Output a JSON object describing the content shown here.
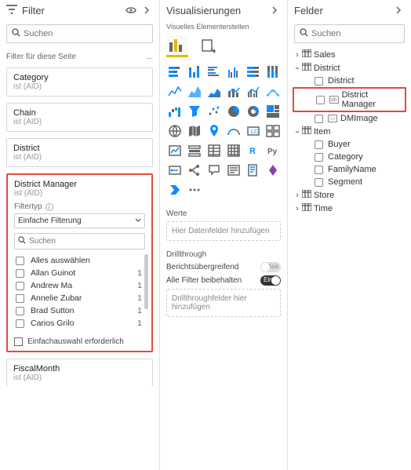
{
  "filter": {
    "title": "Filter",
    "search_placeholder": "Suchen",
    "section_label": "Filter für diese Seite",
    "ellipsis": "...",
    "cards": [
      {
        "title": "Category",
        "sub": "ist (AID)"
      },
      {
        "title": "Chain",
        "sub": "ist (AID)"
      },
      {
        "title": "District",
        "sub": "ist (AID)"
      }
    ],
    "dm": {
      "title": "District Manager",
      "sub": "ist (AID)",
      "filtertyp_label": "Filtertyp",
      "dropdown_value": "Einfache Filterung",
      "search_placeholder": "Suchen",
      "items": [
        {
          "name": "Alles auswählen",
          "count": ""
        },
        {
          "name": "Allan Guinot",
          "count": "1"
        },
        {
          "name": "Andrew Ma",
          "count": "1"
        },
        {
          "name": "Annelie Zubar",
          "count": "1"
        },
        {
          "name": "Brad Sutton",
          "count": "1"
        },
        {
          "name": "Carios Grilo",
          "count": "1"
        }
      ],
      "single_select": "Einfachauswahl erforderlich"
    },
    "fiscal": {
      "title": "FiscalMonth",
      "sub": "ist (AID)"
    }
  },
  "viz": {
    "title": "Visualisierungen",
    "subtitle": "Visuelles Elementerstellen",
    "werte_label": "Werte",
    "werte_placeholder": "Hier Datenfelder hinzufügen",
    "drill_label": "Drillthrough",
    "drill_cross": "Berichtsübergreifend",
    "drill_cross_state": "Aus",
    "drill_keep": "Alle Filter beibehalten",
    "drill_keep_state": "Ein",
    "drill_placeholder": "Drillthroughfelder hier hinzufügen"
  },
  "fields": {
    "title": "Felder",
    "search_placeholder": "Suchen",
    "tables": {
      "sales": "Sales",
      "district": "District",
      "district_cols": {
        "district": "District",
        "manager": "District Manager",
        "dmimage": "DMImage"
      },
      "item": "Item",
      "item_cols": {
        "buyer": "Buyer",
        "category": "Category",
        "family": "FamilyName",
        "segment": "Segment"
      },
      "store": "Store",
      "time": "Time"
    }
  }
}
